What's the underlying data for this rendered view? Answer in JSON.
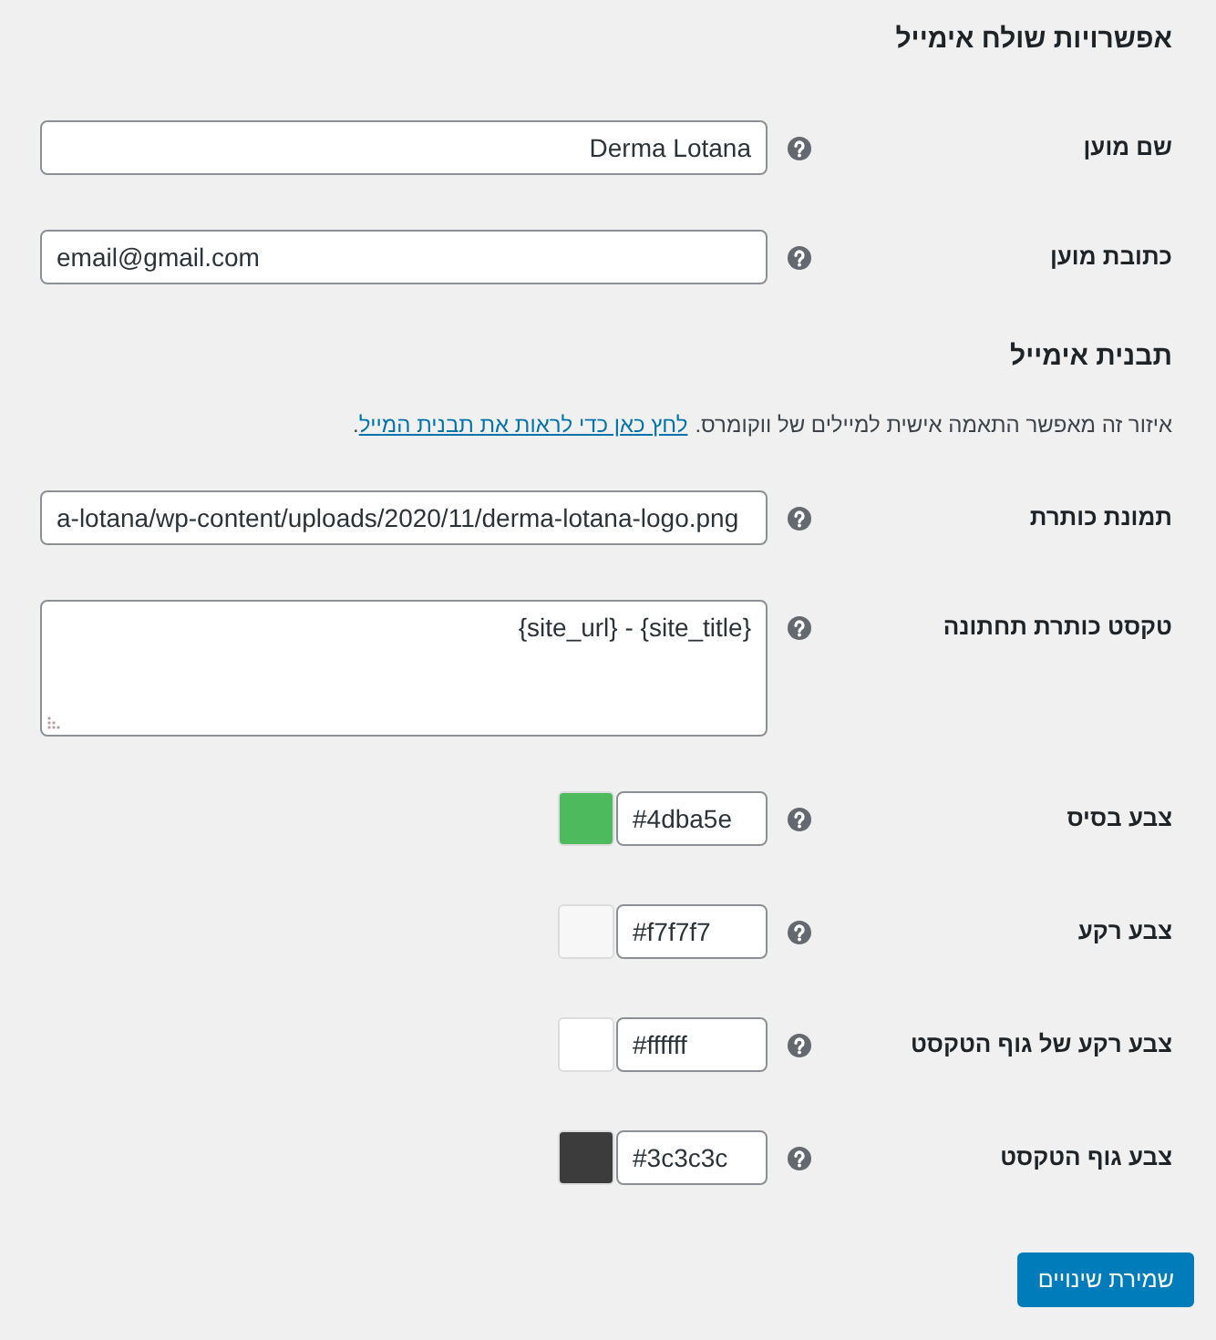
{
  "sections": [
    {
      "title": "אפשרויות שולח אימייל",
      "fields": [
        {
          "kind": "text",
          "label": "שם מוען",
          "value": "Derma Lotana"
        },
        {
          "kind": "email",
          "label": "כתובת מוען",
          "value": "email@gmail.com"
        }
      ]
    },
    {
      "title": "תבנית אימייל",
      "description": {
        "text": "איזור זה מאפשר התאמה אישית למיילים של ווקומרס.",
        "link": "לחץ כאן כדי לראות את תבנית המייל",
        "after": "."
      },
      "fields": [
        {
          "kind": "url",
          "label": "תמונת כותרת",
          "value": "a-lotana/wp-content/uploads/2020/11/derma-lotana-logo.png"
        },
        {
          "kind": "textarea",
          "label": "טקסט כותרת תחתונה",
          "value": "{site_url} - {site_title}"
        },
        {
          "kind": "color",
          "label": "צבע בסיס",
          "value": "#4dba5e",
          "color": "#4dba5e"
        },
        {
          "kind": "color",
          "label": "צבע רקע",
          "value": "#f7f7f7",
          "color": "#f7f7f7"
        },
        {
          "kind": "color",
          "label": "צבע רקע של גוף הטקסט",
          "value": "#ffffff",
          "color": "#ffffff"
        },
        {
          "kind": "color",
          "label": "צבע גוף הטקסט",
          "value": "#3c3c3c",
          "color": "#3c3c3c"
        }
      ]
    }
  ],
  "save_button": {
    "label": "שמירת שינויים"
  }
}
